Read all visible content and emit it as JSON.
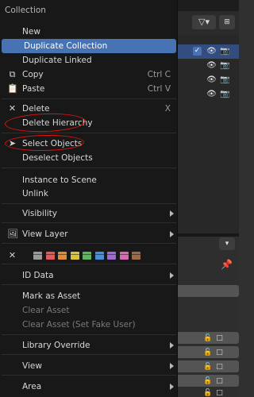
{
  "menu": {
    "title": "Collection",
    "items": {
      "new": "New",
      "duplicate_collection": "Duplicate Collection",
      "duplicate_linked": "Duplicate Linked",
      "copy": "Copy",
      "copy_shortcut": "Ctrl C",
      "paste": "Paste",
      "paste_shortcut": "Ctrl V",
      "delete": "Delete",
      "delete_shortcut": "X",
      "delete_hierarchy": "Delete Hierarchy",
      "select_objects": "Select Objects",
      "deselect_objects": "Deselect Objects",
      "instance_to_scene": "Instance to Scene",
      "unlink": "Unlink",
      "visibility": "Visibility",
      "view_layer": "View Layer",
      "id_data": "ID Data",
      "mark_as_asset": "Mark as Asset",
      "clear_asset": "Clear Asset",
      "clear_asset_fake_user": "Clear Asset (Set Fake User)",
      "library_override": "Library Override",
      "view": "View",
      "area": "Area"
    },
    "color_tags": [
      "#9a9a9a",
      "#e05a5a",
      "#e08a3a",
      "#d8c23a",
      "#5fb45f",
      "#4a8ed8",
      "#9e6ad8",
      "#d86ab0",
      "#9a6a4a"
    ]
  },
  "colors": {
    "highlight": "#4772b3",
    "annotation": "#e01010"
  }
}
